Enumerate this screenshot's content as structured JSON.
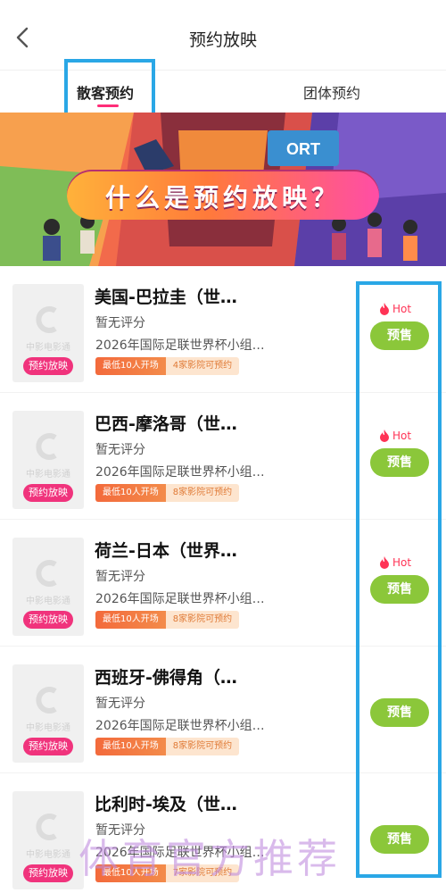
{
  "header": {
    "title": "预约放映",
    "back_icon": "chevron-left-icon"
  },
  "tabs": [
    {
      "label": "散客预约",
      "active": true
    },
    {
      "label": "团体预约",
      "active": false
    }
  ],
  "banner": {
    "headline": "什么是预约放映？"
  },
  "movies": [
    {
      "title": "美国-巴拉圭（世…",
      "rating": "暂无评分",
      "desc": "2026年国际足联世界杯小组…",
      "badge_min": "最低10人开场",
      "badge_cinemas": "4家影院可预约",
      "poster_tag": "预约放映",
      "poster_caption": "中影电影通",
      "hot": "Hot",
      "button": "预售"
    },
    {
      "title": "巴西-摩洛哥（世…",
      "rating": "暂无评分",
      "desc": "2026年国际足联世界杯小组…",
      "badge_min": "最低10人开场",
      "badge_cinemas": "8家影院可预约",
      "poster_tag": "预约放映",
      "poster_caption": "中影电影通",
      "hot": "Hot",
      "button": "预售"
    },
    {
      "title": "荷兰-日本（世界…",
      "rating": "暂无评分",
      "desc": "2026年国际足联世界杯小组…",
      "badge_min": "最低10人开场",
      "badge_cinemas": "8家影院可预约",
      "poster_tag": "预约放映",
      "poster_caption": "中影电影通",
      "hot": "Hot",
      "button": "预售"
    },
    {
      "title": "西班牙-佛得角（…",
      "rating": "暂无评分",
      "desc": "2026年国际足联世界杯小组…",
      "badge_min": "最低10人开场",
      "badge_cinemas": "8家影院可预约",
      "poster_tag": "预约放映",
      "poster_caption": "中影电影通",
      "hot": "",
      "button": "预售"
    },
    {
      "title": "比利时-埃及（世…",
      "rating": "暂无评分",
      "desc": "2026年国际足联世界杯小组…",
      "badge_min": "最低10人开场",
      "badge_cinemas": "7家影院可预约",
      "poster_tag": "预约放映",
      "poster_caption": "中影电影通",
      "hot": "",
      "button": "预售"
    }
  ],
  "watermark": "体育官方推荐",
  "colors": {
    "accent": "#ff2d78",
    "presale": "#8bc73a",
    "highlight": "#2aa7e6",
    "hot": "#ff3355"
  }
}
